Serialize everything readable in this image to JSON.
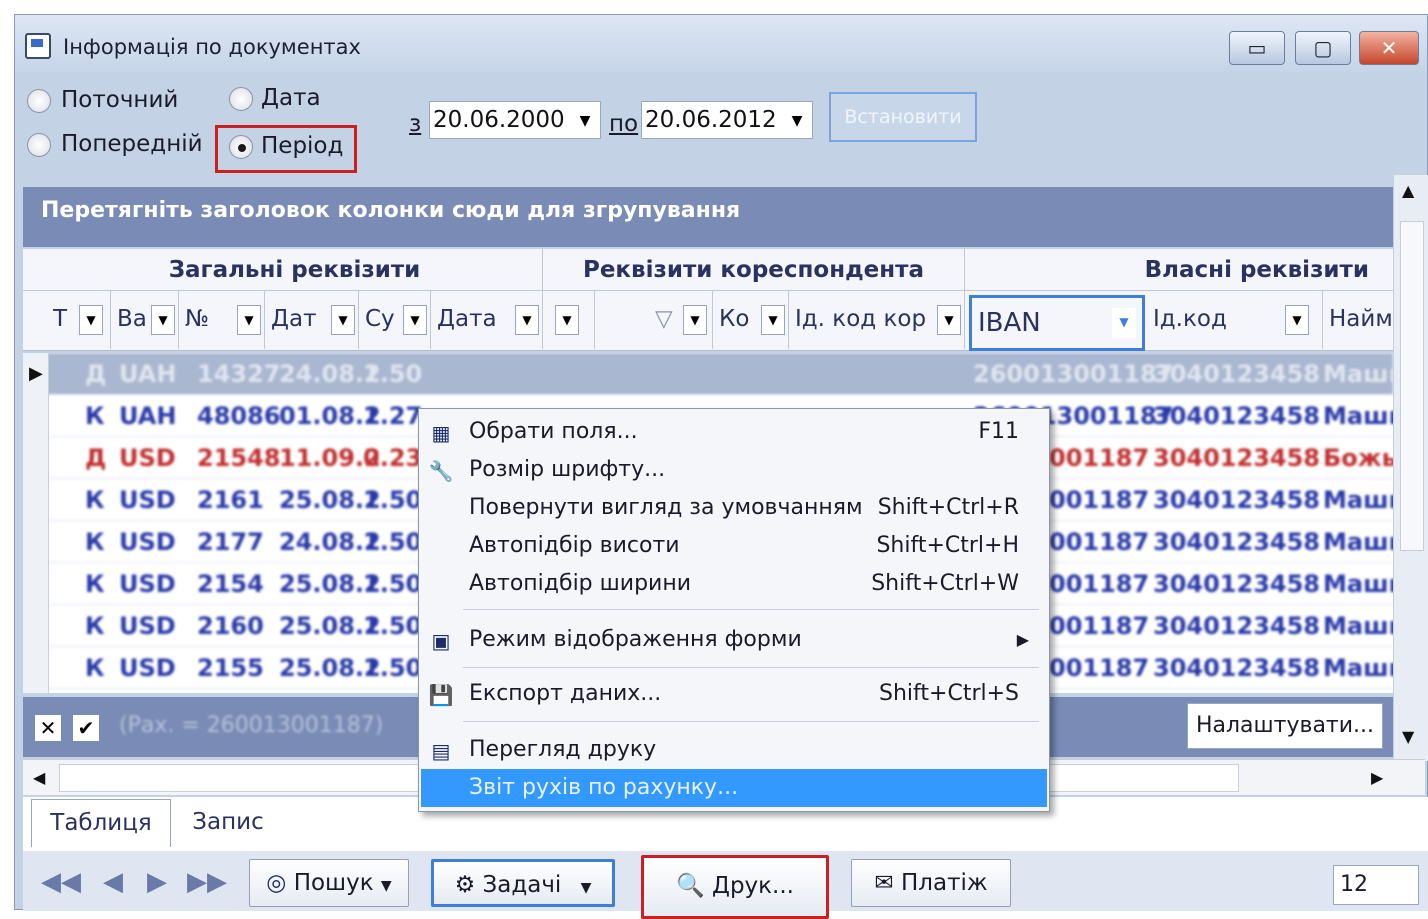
{
  "window": {
    "title": "Інформація по документах",
    "min_glyph": "▭",
    "max_glyph": "▢",
    "close_glyph": "✕"
  },
  "filter": {
    "radio_current": "Поточний",
    "radio_date": "Дата",
    "radio_previous": "Попередній",
    "radio_period": "Період",
    "selected": "Період",
    "from_label": "з",
    "from_value": "20.06.2000",
    "to_label": "по",
    "to_value": "20.06.2012",
    "apply_label": "Встановити"
  },
  "grid": {
    "group_hint": "Перетягніть заголовок колонки сюди для згрупування",
    "bands": [
      "Загальні реквізити",
      "Реквізити кореспондента",
      "Власні реквізити"
    ],
    "columns": [
      "Т",
      "Ва",
      "№",
      "Дат",
      "Су",
      "Дата",
      "",
      "",
      "Ко",
      "Ід. код кор",
      "IBAN",
      "Ід.код",
      "Найме"
    ],
    "rows": [
      {
        "t": "Д",
        "cur": "UAH",
        "num": "14327",
        "date": "24.08.2",
        "sum": "1.50",
        "color": "#2a3aa8"
      },
      {
        "t": "К",
        "cur": "UAH",
        "num": "48086",
        "date": "01.08.2",
        "sum": "1.27",
        "color": "#2a3aa8"
      },
      {
        "t": "Д",
        "cur": "USD",
        "num": "21548",
        "date": "11.09.2",
        "sum": "0.23",
        "color": "#c03030"
      },
      {
        "t": "К",
        "cur": "USD",
        "num": "2161",
        "date": "25.08.2",
        "sum": "1.50",
        "color": "#2a3aa8"
      },
      {
        "t": "К",
        "cur": "USD",
        "num": "2177",
        "date": "24.08.2",
        "sum": "1.50",
        "color": "#2a3aa8"
      },
      {
        "t": "К",
        "cur": "USD",
        "num": "2154",
        "date": "25.08.2",
        "sum": "1.50",
        "color": "#2a3aa8"
      },
      {
        "t": "К",
        "cur": "USD",
        "num": "2160",
        "date": "25.08.2",
        "sum": "1.50",
        "color": "#2a3aa8"
      },
      {
        "t": "К",
        "cur": "USD",
        "num": "2155",
        "date": "25.08.2",
        "sum": "1.50",
        "color": "#2a3aa8"
      }
    ],
    "right_cols": [
      {
        "iban": "260013001187",
        "code": "3040123458",
        "name": "Маши"
      },
      {
        "iban": "260013001187",
        "code": "3040123458",
        "name": "Маши"
      },
      {
        "iban": "001187",
        "code": "3040123458",
        "name": "Божы"
      },
      {
        "iban": "001187",
        "code": "3040123458",
        "name": "Маши"
      },
      {
        "iban": "001187",
        "code": "3040123458",
        "name": "Маши"
      },
      {
        "iban": "001187",
        "code": "3040123458",
        "name": "Маши"
      },
      {
        "iban": "001187",
        "code": "3040123458",
        "name": "Маши"
      },
      {
        "iban": "001187",
        "code": "3040123458",
        "name": "Маши"
      }
    ],
    "filter_text": "(Рах. = 260013001187)",
    "customize_label": "Налаштувати..."
  },
  "context_menu": {
    "items": [
      {
        "label": "Обрати поля...",
        "shortcut": "F11",
        "icon": "fields-icon"
      },
      {
        "label": "Розмір шрифту...",
        "shortcut": "",
        "icon": "wrench-icon"
      },
      {
        "label": "Повернути вигляд за умовчанням",
        "shortcut": "Shift+Ctrl+R",
        "icon": ""
      },
      {
        "label": "Автопідбір висоти",
        "shortcut": "Shift+Ctrl+H",
        "icon": ""
      },
      {
        "label": "Автопідбір ширини",
        "shortcut": "Shift+Ctrl+W",
        "icon": ""
      },
      {
        "label": "Режим відображення форми",
        "shortcut": "",
        "icon": "form-mode-icon"
      },
      {
        "label": "Експорт даних...",
        "shortcut": "Shift+Ctrl+S",
        "icon": "export-icon"
      },
      {
        "label": "Перегляд друку",
        "shortcut": "",
        "icon": "print-preview-icon"
      },
      {
        "label": "Звіт рухів по рахунку...",
        "shortcut": "",
        "icon": ""
      }
    ]
  },
  "tabs": {
    "table": "Таблиця",
    "record": "Запис"
  },
  "toolbar": {
    "search": "Пошук",
    "tasks": "Задачі",
    "print": "Друк...",
    "payment": "Платіж",
    "counter": "12"
  }
}
